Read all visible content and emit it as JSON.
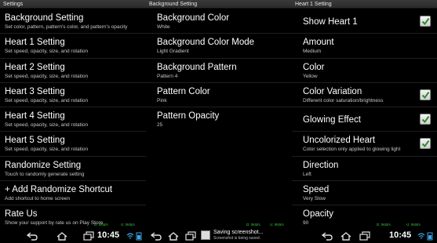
{
  "panel1": {
    "title": "Settings",
    "items": [
      {
        "title": "Background Setting",
        "subtitle": "Set color, pattern, pattern's color, and pattern's opacity"
      },
      {
        "title": "Heart 1 Setting",
        "subtitle": "Set speed, opacity, size, and rotation"
      },
      {
        "title": "Heart 2 Setting",
        "subtitle": "Set speed, opacity, size, and rotation"
      },
      {
        "title": "Heart 3 Setting",
        "subtitle": "Set speed, opacity, size, and rotation"
      },
      {
        "title": "Heart 4 Setting",
        "subtitle": "Set speed, opacity, size, and rotation"
      },
      {
        "title": "Heart 5 Setting",
        "subtitle": "Set speed, opacity, size, and rotation"
      },
      {
        "title": "Randomize Setting",
        "subtitle": "Touch to randomly generate setting"
      },
      {
        "title": "+ Add Randomize Shortcut",
        "subtitle": "Add shortcut to home screen"
      },
      {
        "title": "Rate Us",
        "subtitle": "Show your support by rate us on Play Store"
      }
    ],
    "navbar": {
      "clock": "10:45",
      "net_down": "D: 0KB/s",
      "net_up": "U: 0KB/s"
    }
  },
  "panel2": {
    "title": "Background Setting",
    "items": [
      {
        "title": "Background Color",
        "subtitle": "White"
      },
      {
        "title": "Background Color Mode",
        "subtitle": "Light Gradient"
      },
      {
        "title": "Background Pattern",
        "subtitle": "Pattern 4"
      },
      {
        "title": "Pattern Color",
        "subtitle": "Pink"
      },
      {
        "title": "Pattern Opacity",
        "subtitle": "25"
      }
    ],
    "navbar": {
      "toast_title": "Saving screenshot...",
      "toast_sub": "Screenshot is being saved.",
      "net_down": "D: 0KB/s",
      "net_up": "U: 0KB/s"
    }
  },
  "panel3": {
    "title": "Heart 1 Setting",
    "items": [
      {
        "title": "Show Heart 1",
        "subtitle": "",
        "checked": true
      },
      {
        "title": "Amount",
        "subtitle": "Medium"
      },
      {
        "title": "Color",
        "subtitle": "Yellow"
      },
      {
        "title": "Color Variation",
        "subtitle": "Different color saturation/brightness",
        "checked": true
      },
      {
        "title": "Glowing Effect",
        "subtitle": "",
        "checked": true
      },
      {
        "title": "Uncolorized Heart",
        "subtitle": "Color selection only applied to glowing light",
        "checked": true
      },
      {
        "title": "Direction",
        "subtitle": "Left"
      },
      {
        "title": "Speed",
        "subtitle": "Very Slow"
      },
      {
        "title": "Opacity",
        "subtitle": "90"
      }
    ],
    "navbar": {
      "clock": "10:45",
      "net_down": "D: 0KB/s",
      "net_up": "U: 0KB/s"
    }
  },
  "colors": {
    "background": "#000000",
    "checkmark": "#2e8b2e",
    "net_text": "#35c835"
  },
  "icons": [
    "back-icon",
    "home-icon",
    "recent-apps-icon",
    "usb-icon",
    "wifi-icon",
    "battery-icon",
    "image-icon"
  ]
}
